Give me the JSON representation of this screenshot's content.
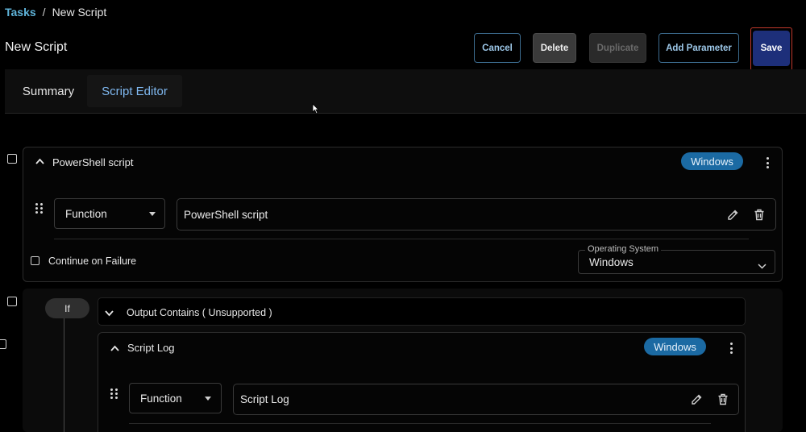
{
  "breadcrumb": {
    "root": "Tasks",
    "separator": "/",
    "current": "New Script"
  },
  "header": {
    "title": "New Script"
  },
  "toolbar": {
    "cancel": "Cancel",
    "delete": "Delete",
    "duplicate": "Duplicate",
    "add_parameter": "Add Parameter",
    "save": "Save"
  },
  "tabs": {
    "summary": "Summary",
    "editor": "Script Editor"
  },
  "step1": {
    "title": "PowerShell script",
    "os_badge": "Windows",
    "type_select": "Function",
    "function_value": "PowerShell script",
    "continue_label": "Continue on Failure",
    "os_label": "Operating System",
    "os_value": "Windows"
  },
  "condition": {
    "if_label": "If",
    "header": "Output Contains ( Unsupported )"
  },
  "step2": {
    "title": "Script Log",
    "os_badge": "Windows",
    "type_select": "Function",
    "function_value": "Script Log"
  },
  "colors": {
    "accent_link": "#5fb3d9",
    "badge": "#1b6aa3",
    "save": "#1d2f7a",
    "save_focus": "#c0392b"
  }
}
